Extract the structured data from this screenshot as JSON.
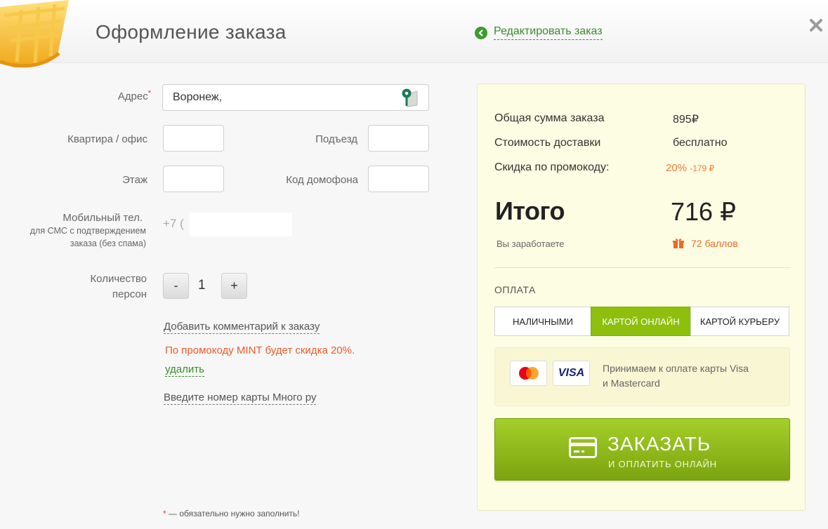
{
  "header": {
    "title": "Оформление заказа",
    "edit_link": "Редактировать заказ"
  },
  "form": {
    "address_label": "Адрес",
    "required_mark": "*",
    "address_value": "Воронеж,",
    "apartment_label": "Квартира / офис",
    "entrance_label": "Подъезд",
    "floor_label": "Этаж",
    "intercom_label": "Код домофона",
    "phone_label_1": "Мобильный тел.",
    "phone_label_2": "для СМС с подтверждением",
    "phone_label_3": "заказа (без спама)",
    "phone_prefix": "+7 (",
    "persons_label_1": "Количество",
    "persons_label_2": "персон",
    "minus": "-",
    "plus": "+",
    "quantity": "1",
    "add_comment": "Добавить комментарий к заказу",
    "promo_message": "По промокоду MINT будет скидка 20%.",
    "delete_link": "удалить",
    "card_number_link": "Введите номер карты Много ру",
    "footnote": "— обязательно нужно заполнить!"
  },
  "summary": {
    "order_sum_label": "Общая сумма заказа",
    "order_sum_value": "895₽",
    "delivery_label": "Стоимость доставки",
    "delivery_value": "бесплатно",
    "discount_label": "Скидка по промокоду:",
    "discount_percent": "20%",
    "discount_amount": "-179 ₽",
    "total_label": "Итого",
    "total_value": "716 ₽",
    "earn_label": "Вы заработаете",
    "points_value": "72 баллов"
  },
  "payment": {
    "title": "ОПЛАТА",
    "tabs": [
      "НАЛИЧНЫМИ",
      "КАРТОЙ ОНЛАЙН",
      "КАРТОЙ КУРЬЕРУ"
    ],
    "active_tab": 1,
    "cards_text_1": "Принимаем к оплате карты Visa",
    "cards_text_2": "и Mastercard",
    "visa_label": "VISA",
    "order_button_main": "ЗАКАЗАТЬ",
    "order_button_sub": "И ОПЛАТИТЬ ОНЛАЙН"
  },
  "colors": {
    "accent_green": "#8dbf0c",
    "link_green": "#3a8a2e",
    "promo_orange": "#ef5a28",
    "panel_bg": "#fdfde3"
  },
  "icons": [
    "basket-icon",
    "back-arrow-icon",
    "close-icon",
    "map-pin-icon",
    "gift-icon",
    "mastercard-icon",
    "visa-icon",
    "credit-card-icon"
  ]
}
